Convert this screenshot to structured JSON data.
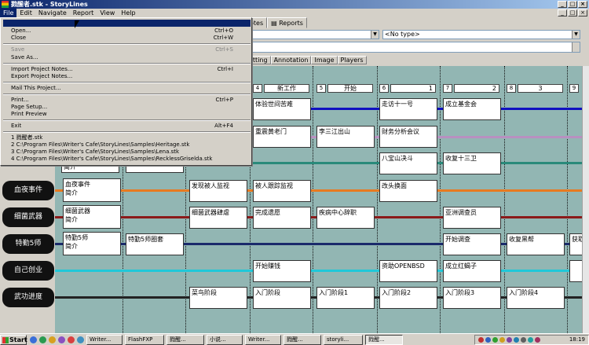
{
  "window": {
    "title": "戮醒者.stk - StoryLines",
    "min": "_",
    "max": "□",
    "close": "×",
    "accent": "#0a246a"
  },
  "menubar": [
    "File",
    "Edit",
    "Navigate",
    "Report",
    "View",
    "Help"
  ],
  "tabs": [
    "otes",
    "Reports"
  ],
  "fields": {
    "combo_left": "",
    "type_select": "<No type>"
  },
  "subtabs": [
    "etting",
    "Annotation",
    "Image",
    "Players"
  ],
  "file_menu": {
    "items": [
      {
        "label": "",
        "shortcut": ""
      },
      {
        "label": "Open...",
        "shortcut": "Ctrl+O"
      },
      {
        "label": "Close",
        "shortcut": "Ctrl+W"
      },
      {
        "label": "Save",
        "shortcut": "Ctrl+S",
        "disabled": true
      },
      {
        "label": "Save As...",
        "shortcut": ""
      },
      {
        "label": "Import Project Notes...",
        "shortcut": "Ctrl+I"
      },
      {
        "label": "Export Project Notes...",
        "shortcut": ""
      },
      {
        "label": "Mail This Project...",
        "shortcut": ""
      },
      {
        "label": "Print...",
        "shortcut": "Ctrl+P"
      },
      {
        "label": "Page Setup...",
        "shortcut": ""
      },
      {
        "label": "Print Preview",
        "shortcut": ""
      },
      {
        "label": "Exit",
        "shortcut": "Alt+F4"
      },
      {
        "label": "1 戮醒者.stk",
        "shortcut": ""
      },
      {
        "label": "2 C:\\Program Files\\Writer's Cafe\\StoryLines\\Samples\\Heritage.stk",
        "shortcut": ""
      },
      {
        "label": "3 C:\\Program Files\\Writer's Cafe\\StoryLines\\Samples\\Lena.stk",
        "shortcut": ""
      },
      {
        "label": "4 C:\\Program Files\\Writer's Cafe\\StoryLines\\Samples\\RecklessGriselda.stk",
        "shortcut": ""
      }
    ]
  },
  "columns": [
    {
      "num": "4",
      "title": "新工作"
    },
    {
      "num": "5",
      "title": "开始"
    },
    {
      "num": "6",
      "title": "1"
    },
    {
      "num": "7",
      "title": "2"
    },
    {
      "num": "8",
      "title": "3"
    },
    {
      "num": "9",
      "title": ""
    }
  ],
  "tracks": [
    {
      "label": "血夜事件",
      "color": "#e87a20"
    },
    {
      "label": "细菌武器",
      "color": "#8b1a1a"
    },
    {
      "label": "特勤5师",
      "color": "#1a2a6b"
    },
    {
      "label": "自己创业",
      "color": "#20c8d8"
    },
    {
      "label": "武功进度",
      "color": "#222222"
    }
  ],
  "top_lines": [
    {
      "color": "#1010c0"
    },
    {
      "color": "#b890c0"
    },
    {
      "color": "#2a8a7a"
    }
  ],
  "cards": {
    "r0": [
      "体验世间苦难",
      "走访十一号",
      "成立基金会"
    ],
    "r1": [
      "重震黄老门",
      "李三江出山",
      "财务分析会议"
    ],
    "r2": [
      "简介",
      "八宝山决斗",
      "收复十三卫"
    ],
    "xue": [
      "血夜事件\n简介",
      "发现被人监视",
      "被人跟踪监视",
      "改头换面"
    ],
    "xi": [
      "细菌武器\n简介",
      "细菌武器肆虐",
      "完成遗愿",
      "疾病中心辞职",
      "亚洲调查员"
    ],
    "te": [
      "特勤5师\n简介",
      "特勤5师圈套",
      "开始调查",
      "收复黑帮",
      "获取"
    ],
    "zi": [
      "开始赚钱",
      "资助OPENBSD",
      "成立红蝎子"
    ],
    "wu": [
      "菜鸟阶段",
      "入门阶段",
      "入门阶段1",
      "入门阶段2",
      "入门阶段3",
      "入门阶段4"
    ]
  },
  "taskbar": {
    "start": "Start",
    "buttons": [
      "Writer...",
      "FlashFXP",
      "戮醒...",
      "小说...",
      "Writer...",
      "戮醒...",
      "storyli...",
      "戮醒..."
    ],
    "clock": "18:19"
  }
}
